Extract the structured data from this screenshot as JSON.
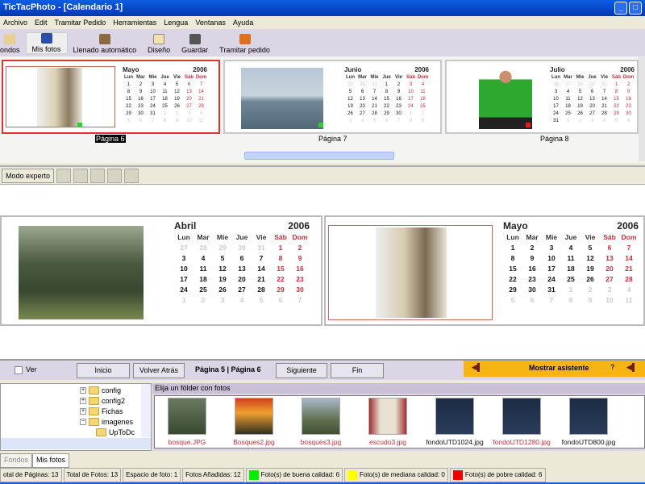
{
  "window": {
    "title": "TicTacPhoto - [Calendario 1]"
  },
  "menu": [
    "Archivo",
    "Edit",
    "Tramitar Pedido",
    "Herramientas",
    "Lengua",
    "Ventanas",
    "Ayuda"
  ],
  "toolbar": {
    "fondos": "ondos",
    "mis_fotos": "Mis fotos",
    "llenado": "Llenado automático",
    "diseno": "Diseño",
    "guardar": "Guardar",
    "tramitar": "Tramitar pedido"
  },
  "weekdays": [
    "Lun",
    "Mar",
    "Mie",
    "Jue",
    "Vie",
    "Sáb",
    "Dom"
  ],
  "thumbnails": [
    {
      "label": "Página 6",
      "month": "Mayo",
      "year": "2006",
      "offset": 0,
      "prev_days": 30,
      "days": 31,
      "quality": "#33cc33"
    },
    {
      "label": "Página 7",
      "month": "Junio",
      "year": "2006",
      "offset": 3,
      "prev_days": 31,
      "days": 30,
      "quality": "#33cc33"
    },
    {
      "label": "Página 8",
      "month": "Julio",
      "year": "2006",
      "offset": 5,
      "prev_days": 30,
      "days": 31,
      "quality": "#dd2222"
    }
  ],
  "modebar": {
    "expert": "Modo experto"
  },
  "pages": [
    {
      "month": "Abril",
      "year": "2006",
      "offset": 5,
      "prev_days": 31,
      "days": 30
    },
    {
      "month": "Mayo",
      "year": "2006",
      "offset": 0,
      "prev_days": 30,
      "days": 31
    }
  ],
  "nav": {
    "ver": "Ver",
    "inicio": "Inicio",
    "atras": "Volver Atrás",
    "pagina": "Página 5 | Página 6",
    "siguiente": "Siguiente",
    "fin": "Fin",
    "asistente": "Mostrar asistente"
  },
  "tree": [
    {
      "name": "config",
      "sign": "+"
    },
    {
      "name": "config2",
      "sign": "+"
    },
    {
      "name": "Fichas",
      "sign": "+"
    },
    {
      "name": "imagenes",
      "sign": "−"
    },
    {
      "name": "UpToDc",
      "sign": ""
    }
  ],
  "photos": {
    "header": "Elija un fólder con fotos",
    "items": [
      {
        "name": "bosque.JPG",
        "bad": true
      },
      {
        "name": "Bosques2.jpg",
        "bad": true
      },
      {
        "name": "bosques3.jpg",
        "bad": true
      },
      {
        "name": "escudo3.jpg",
        "bad": true
      },
      {
        "name": "fondoUTD1024.jpg",
        "bad": false
      },
      {
        "name": "fondoUTD1280.jpg",
        "bad": true
      },
      {
        "name": "fondoUTD800.jpg",
        "bad": false
      }
    ]
  },
  "tabs": {
    "fondos": "Fondos",
    "mis_fotos": "Mis fotos"
  },
  "status": {
    "paginas": "otal de Páginas: 13",
    "fotos": "Total de Fotos: 13",
    "espacio": "Espacio de foto: 1",
    "anadidas": "Fotos Añadidas: 12",
    "buena": "Foto(s) de buena calidad: 6",
    "mediana": "Foto(s) de mediana calidad: 0",
    "pobre": "Foto(s) de pobre calidad: 6"
  },
  "colors": {
    "good": "#00ee00",
    "medium": "#ffff00",
    "poor": "#ee0000",
    "weekend": "#c0303a"
  }
}
